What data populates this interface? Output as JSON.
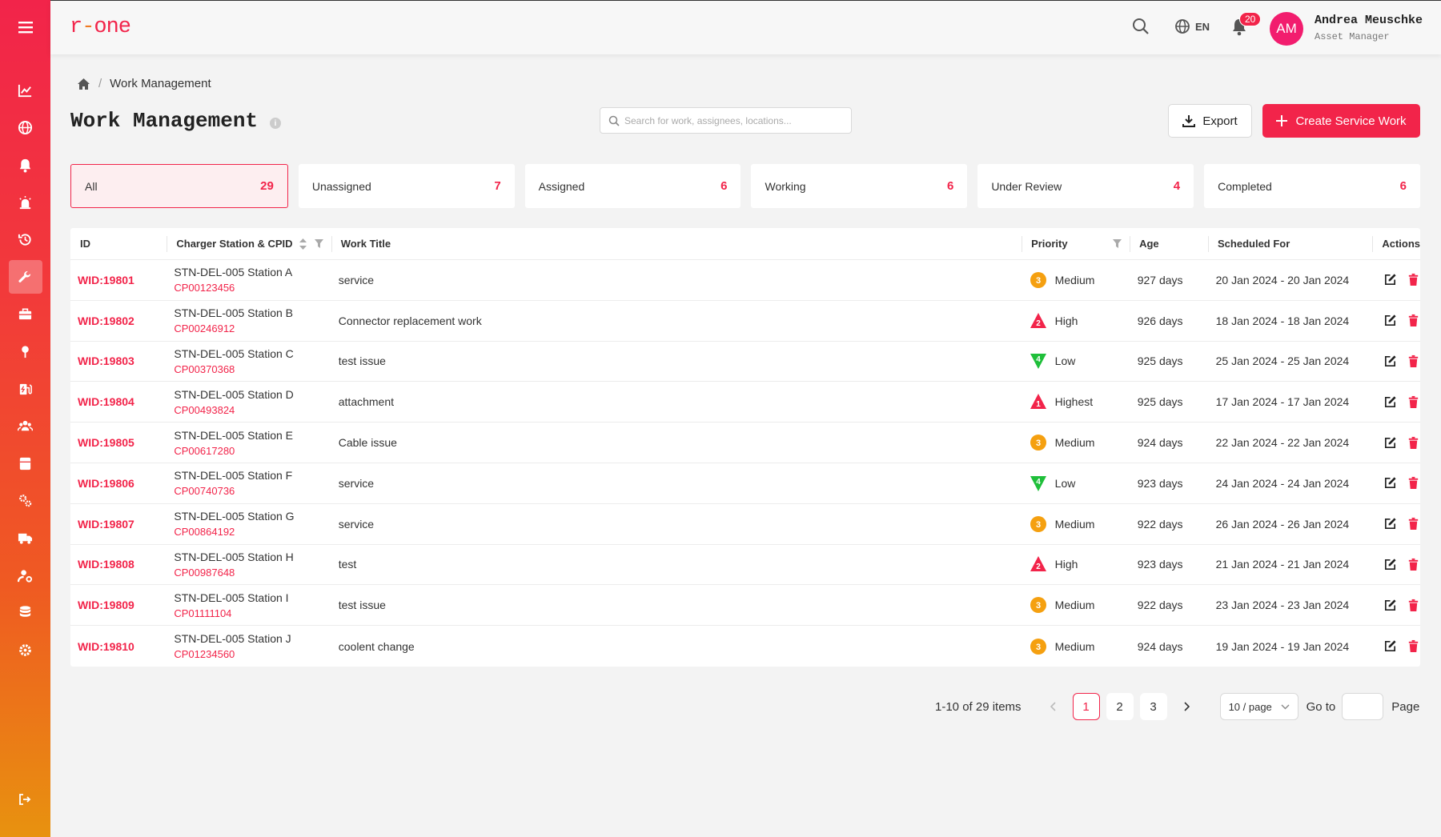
{
  "app": {
    "logo": "r-one"
  },
  "sidebar": {
    "items": [
      {
        "name": "chart-line-icon"
      },
      {
        "name": "globe-icon"
      },
      {
        "name": "bell-icon"
      },
      {
        "name": "alarm-icon"
      },
      {
        "name": "history-icon"
      },
      {
        "name": "wrench-icon",
        "active": true
      },
      {
        "name": "toolbox-icon"
      },
      {
        "name": "map-pin-icon"
      },
      {
        "name": "charging-station-icon"
      },
      {
        "name": "users-icon"
      },
      {
        "name": "archive-icon"
      },
      {
        "name": "gears-icon"
      },
      {
        "name": "truck-icon"
      },
      {
        "name": "user-settings-icon"
      },
      {
        "name": "database-icon"
      },
      {
        "name": "settings-icon"
      }
    ]
  },
  "header": {
    "language": "EN",
    "notification_count": "20",
    "user": {
      "initials": "AM",
      "name": "Andrea Meuschke",
      "role": "Asset Manager"
    }
  },
  "breadcrumb": {
    "current": "Work Management"
  },
  "page": {
    "title": "Work Management",
    "search_placeholder": "Search for work, assignees, locations...",
    "export_label": "Export",
    "create_label": "Create Service Work"
  },
  "tabs": [
    {
      "label": "All",
      "count": "29"
    },
    {
      "label": "Unassigned",
      "count": "7"
    },
    {
      "label": "Assigned",
      "count": "6"
    },
    {
      "label": "Working",
      "count": "6"
    },
    {
      "label": "Under Review",
      "count": "4"
    },
    {
      "label": "Completed",
      "count": "6"
    }
  ],
  "table": {
    "headers": {
      "id": "ID",
      "station": "Charger Station & CPID",
      "title": "Work Title",
      "priority": "Priority",
      "age": "Age",
      "scheduled": "Scheduled For",
      "actions": "Actions"
    },
    "rows": [
      {
        "id": "WID:19801",
        "station": "STN-DEL-005 Station A",
        "cpid": "CP00123456",
        "title": "service",
        "priority": "Medium",
        "priority_level": "3",
        "age": "927 days",
        "scheduled": "20 Jan 2024 - 20 Jan 2024"
      },
      {
        "id": "WID:19802",
        "station": "STN-DEL-005 Station B",
        "cpid": "CP00246912",
        "title": "Connector replacement work",
        "priority": "High",
        "priority_level": "2",
        "age": "926 days",
        "scheduled": "18 Jan 2024 - 18 Jan 2024"
      },
      {
        "id": "WID:19803",
        "station": "STN-DEL-005 Station C",
        "cpid": "CP00370368",
        "title": "test issue",
        "priority": "Low",
        "priority_level": "4",
        "age": "925 days",
        "scheduled": "25 Jan 2024 - 25 Jan 2024"
      },
      {
        "id": "WID:19804",
        "station": "STN-DEL-005 Station D",
        "cpid": "CP00493824",
        "title": "attachment",
        "priority": "Highest",
        "priority_level": "1",
        "age": "925 days",
        "scheduled": "17 Jan 2024 - 17 Jan 2024"
      },
      {
        "id": "WID:19805",
        "station": "STN-DEL-005 Station E",
        "cpid": "CP00617280",
        "title": "Cable issue",
        "priority": "Medium",
        "priority_level": "3",
        "age": "924 days",
        "scheduled": "22 Jan 2024 - 22 Jan 2024"
      },
      {
        "id": "WID:19806",
        "station": "STN-DEL-005 Station F",
        "cpid": "CP00740736",
        "title": "service",
        "priority": "Low",
        "priority_level": "4",
        "age": "923 days",
        "scheduled": "24 Jan 2024 - 24 Jan 2024"
      },
      {
        "id": "WID:19807",
        "station": "STN-DEL-005 Station G",
        "cpid": "CP00864192",
        "title": "service",
        "priority": "Medium",
        "priority_level": "3",
        "age": "922 days",
        "scheduled": "26 Jan 2024 - 26 Jan 2024"
      },
      {
        "id": "WID:19808",
        "station": "STN-DEL-005 Station H",
        "cpid": "CP00987648",
        "title": "test",
        "priority": "High",
        "priority_level": "2",
        "age": "923 days",
        "scheduled": "21 Jan 2024 - 21 Jan 2024"
      },
      {
        "id": "WID:19809",
        "station": "STN-DEL-005 Station I",
        "cpid": "CP01111104",
        "title": "test issue",
        "priority": "Medium",
        "priority_level": "3",
        "age": "922 days",
        "scheduled": "23 Jan 2024 - 23 Jan 2024"
      },
      {
        "id": "WID:19810",
        "station": "STN-DEL-005 Station J",
        "cpid": "CP01234560",
        "title": "coolent change",
        "priority": "Medium",
        "priority_level": "3",
        "age": "924 days",
        "scheduled": "19 Jan 2024 - 19 Jan 2024"
      }
    ]
  },
  "pagination": {
    "summary": "1-10 of 29 items",
    "pages": [
      "1",
      "2",
      "3"
    ],
    "current": "1",
    "page_size": "10 / page",
    "goto_label": "Go to",
    "page_label": "Page"
  },
  "colors": {
    "brand": "#f2244a",
    "medium": "#f5a010",
    "high": "#f2244a",
    "low": "#1fbf3a"
  }
}
